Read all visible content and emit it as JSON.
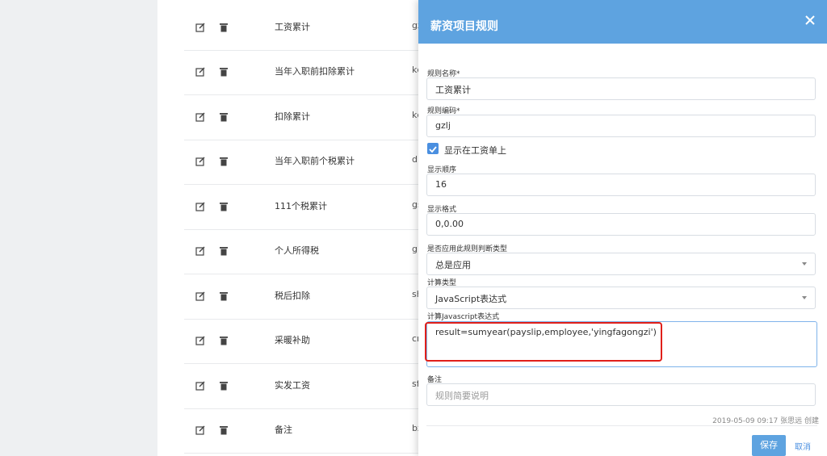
{
  "list": {
    "rows": [
      {
        "name": "工资累计",
        "code": "gz"
      },
      {
        "name": "当年入职前扣除累计",
        "code": "kc"
      },
      {
        "name": "扣除累计",
        "code": "kc"
      },
      {
        "name": "当年入职前个税累计",
        "code": "dn"
      },
      {
        "name": "111个税累计",
        "code": "gs"
      },
      {
        "name": "个人所得税",
        "code": "gr"
      },
      {
        "name": "税后扣除",
        "code": "sh"
      },
      {
        "name": "采暖补助",
        "code": "cn"
      },
      {
        "name": "实发工资",
        "code": "sf"
      },
      {
        "name": "备注",
        "code": "bz"
      }
    ]
  },
  "panel": {
    "title": "薪资项目规则",
    "close_icon": "close-icon",
    "rule_name_label": "规则名称*",
    "rule_name_value": "工资累计",
    "rule_code_label": "规则编码*",
    "rule_code_value": "gzlj",
    "show_on_payslip_label": "显示在工资单上",
    "show_on_payslip_checked": true,
    "display_order_label": "显示顺序",
    "display_order_value": "16",
    "display_format_label": "显示格式",
    "display_format_value": "0,0.00",
    "apply_rule_label": "是否应用此规则判断类型",
    "apply_rule_value": "总是应用",
    "calc_type_label": "计算类型",
    "calc_type_value": "JavaScript表达式",
    "js_expr_label": "计算Javascript表达式",
    "js_expr_value": "result=sumyear(payslip,employee,'yingfagongzi')",
    "remark_label": "备注",
    "remark_placeholder": "规则简要说明",
    "meta": "2019-05-09 09:17 张思远 创建",
    "save_label": "保存",
    "cancel_label": "取消"
  },
  "colors": {
    "header": "#5ea3e0",
    "accent": "#4a8fe0",
    "highlight": "#e0201a"
  }
}
